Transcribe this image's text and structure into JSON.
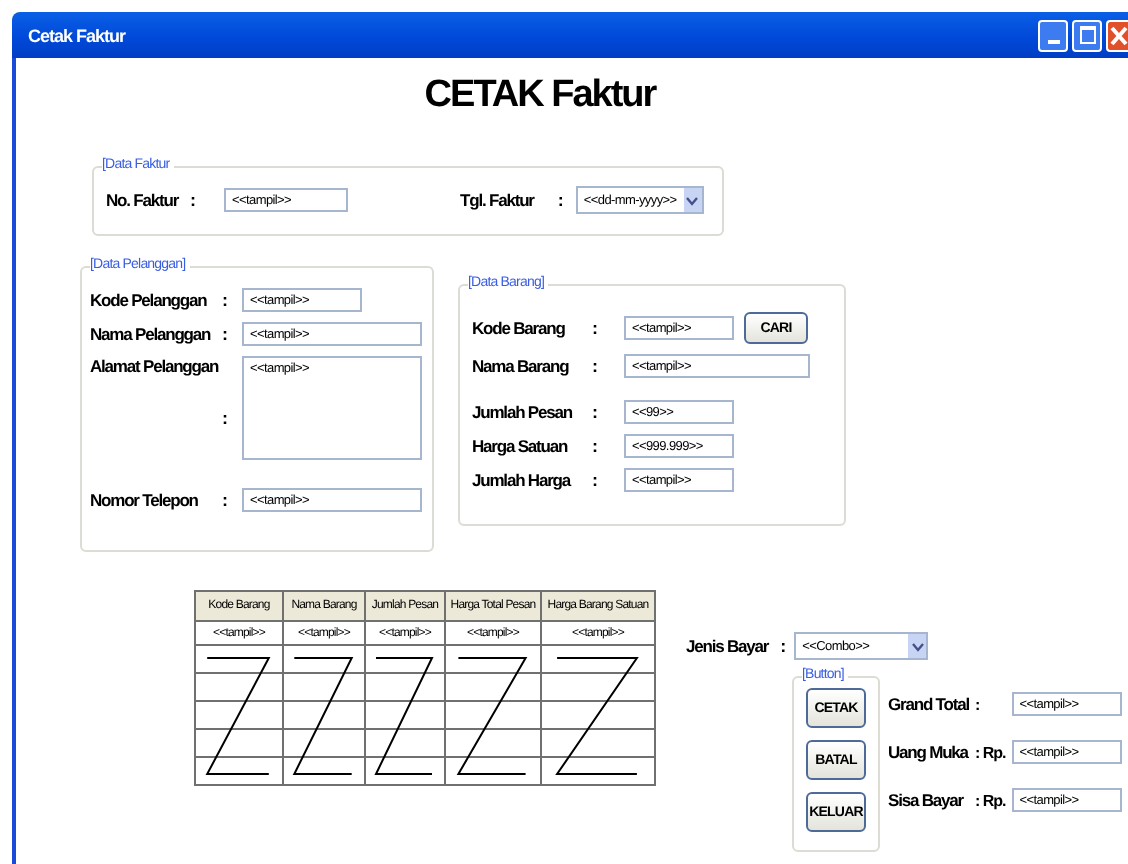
{
  "window": {
    "title": "Cetak Faktur"
  },
  "heading": "CETAK Faktur",
  "data_faktur": {
    "legend": "[Data Faktur",
    "no_faktur": {
      "label": "No. Faktur",
      "colon": ":",
      "value": "<<tampil>>"
    },
    "tgl_faktur": {
      "label": "Tgl. Faktur",
      "colon": ":",
      "value": "<<dd-mm-yyyy>>"
    }
  },
  "data_pelanggan": {
    "legend": "[Data Pelanggan]",
    "rows": [
      {
        "kind": "text",
        "label": "Kode Pelanggan",
        "colon": ":",
        "value": "<<tampil>>"
      },
      {
        "kind": "text",
        "label": "Nama Pelanggan",
        "colon": ":",
        "value": "<<tampil>>"
      },
      {
        "kind": "textarea",
        "label": "Alamat Pelanggan",
        "colon": ":",
        "value": "<<tampil>>"
      },
      {
        "kind": "text",
        "label": "Nomor Telepon",
        "colon": ":",
        "value": "<<tampil>>"
      }
    ]
  },
  "data_barang": {
    "legend": "[Data Barang]",
    "rows": [
      {
        "kind": "button",
        "label": "Kode Barang",
        "colon": ":",
        "value": "<<tampil>>",
        "button": "CARI"
      },
      {
        "kind": "text",
        "label": "Nama Barang",
        "colon": ":",
        "value": "<<tampil>>"
      },
      {
        "kind": "text",
        "label": "Jumlah Pesan",
        "colon": ":",
        "value": "<<99>>"
      },
      {
        "kind": "text",
        "label": "Harga Satuan",
        "colon": ":",
        "value": "<<999.999>>"
      },
      {
        "kind": "text",
        "label": "Jumlah Harga",
        "colon": ":",
        "value": "<<tampil>>"
      }
    ]
  },
  "table": {
    "columns": [
      "Kode Barang",
      "Nama Barang",
      "Jumlah Pesan",
      "Harga Total Pesan",
      "Harga Barang Satuan"
    ],
    "rows": [
      [
        "<<tampil>>",
        "<<tampil>>",
        "<<tampil>>",
        "<<tampil>>",
        "<<tampil>>"
      ]
    ]
  },
  "jenis_bayar": {
    "label": "Jenis Bayar",
    "colon": ":",
    "value": "<<Combo>>"
  },
  "button_panel": {
    "legend": "[Button]",
    "buttons": [
      "CETAK",
      "BATAL",
      "KELUAR"
    ]
  },
  "totals": [
    {
      "label": "Grand Total",
      "prefix": ":",
      "value": "<<tampil>>"
    },
    {
      "label": "Uang Muka",
      "prefix": ": Rp.",
      "value": "<<tampil>>"
    },
    {
      "label": "Sisa Bayar",
      "prefix": ": Rp.",
      "value": "<<tampil>>"
    }
  ]
}
